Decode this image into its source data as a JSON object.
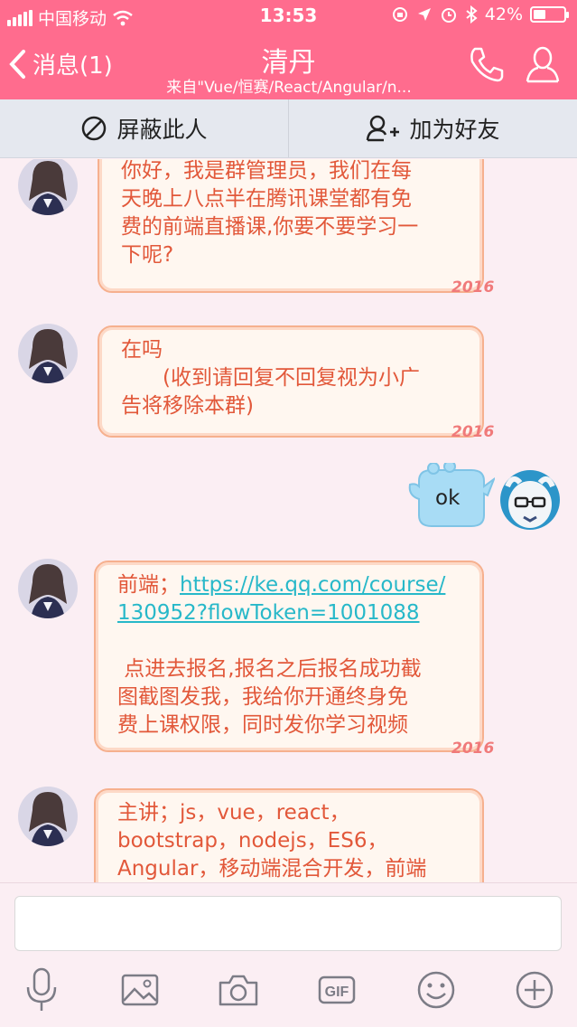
{
  "status": {
    "carrier": "中国移动",
    "time": "13:53",
    "battery_percent": "42%",
    "battery_level": 0.42
  },
  "nav": {
    "back_label": "消息(1)",
    "title": "清丹",
    "subtitle": "来自\"Vue/恒赛/React/Angular/n..."
  },
  "actions": {
    "block_label": "屏蔽此人",
    "add_friend_label": "加为好友"
  },
  "messages": [
    {
      "from": "other",
      "lines": [
        "你好，我是群管理员，我们在每",
        "天晚上八点半在腾讯课堂都有免",
        "费的前端直播课,你要不要学习一",
        "下呢?"
      ]
    },
    {
      "from": "other",
      "lines": [
        "在吗",
        "　　(收到请回复不回复视为小广",
        "告将移除本群)"
      ]
    },
    {
      "from": "self",
      "text": "ok"
    },
    {
      "from": "other",
      "prefix": "前端；",
      "link_line1": "https://ke.qq.com/course/",
      "link_line2": "130952?flowToken=1001088",
      "lines": [
        " 点进去报名,报名之后报名成功截",
        "图截图发我，我给你开通终身免",
        "费上课权限，同时发你学习视频"
      ]
    },
    {
      "from": "other",
      "lines": [
        "主讲；js，vue，react，",
        "bootstrap，nodejs，ES6，",
        "Angular，移动端混合开发，前端"
      ]
    }
  ],
  "bubble_deco": "2016",
  "colors": {
    "header": "#ff6c8e",
    "bubble_text": "#e2583a",
    "link": "#27b8c9",
    "self_bubble": "#a8dcf5"
  },
  "input": {
    "placeholder": ""
  },
  "toolbar": [
    "mic-icon",
    "image-icon",
    "camera-icon",
    "gif-icon",
    "emoji-icon",
    "plus-icon"
  ]
}
